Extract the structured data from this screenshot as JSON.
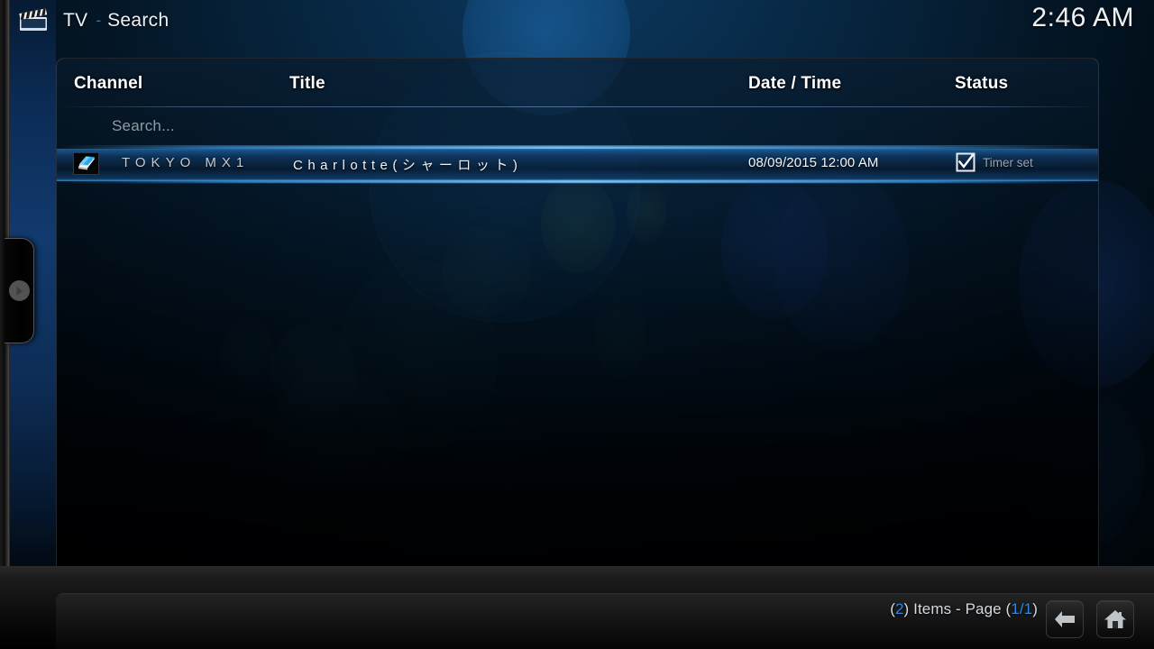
{
  "header": {
    "icon": "clapperboard-icon",
    "section": "TV",
    "separator": "-",
    "page": "Search",
    "clock": "2:46 AM",
    "accent_color": "#1c7fe0"
  },
  "table": {
    "columns": [
      {
        "key": "channel",
        "label": "Channel"
      },
      {
        "key": "title",
        "label": "Title"
      },
      {
        "key": "datetime",
        "label": "Date / Time"
      },
      {
        "key": "status",
        "label": "Status"
      }
    ],
    "search_row": {
      "placeholder": "Search..."
    },
    "rows": [
      {
        "selected": true,
        "channel_icon": "channel-logo-icon",
        "channel": "TOKYO MX1",
        "title": "Charlotte(シャーロット)",
        "datetime": "08/09/2015 12:00 AM",
        "status_icon": "timer-check-icon",
        "status": "Timer set"
      }
    ]
  },
  "footer": {
    "item_count": "2",
    "items_label": "Items - Page",
    "page": "1/1",
    "open_paren": "(",
    "close_paren": ")",
    "back_button": "back-arrow-icon",
    "home_button": "home-icon"
  },
  "sidebar": {
    "flyout_toggle": "expand-sidebar-arrow-icon"
  }
}
